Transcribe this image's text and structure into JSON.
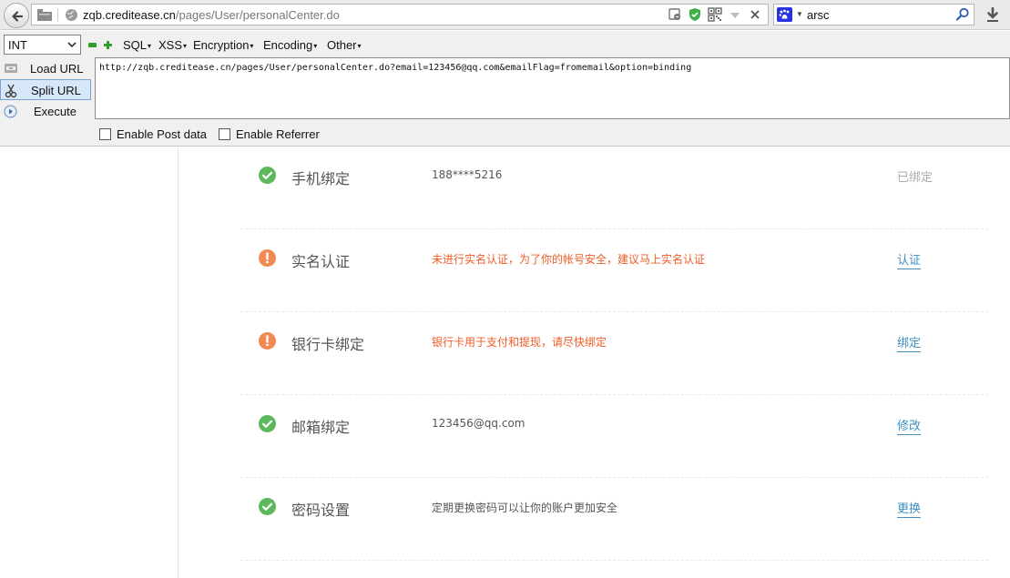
{
  "browser": {
    "address_bar": {
      "host": "zqb.creditease.cn",
      "path": "/pages/User/personalCenter.do"
    },
    "search": {
      "value": "arsc"
    }
  },
  "hackbar": {
    "select_value": "INT",
    "menus": [
      "SQL",
      "XSS",
      "Encryption",
      "Encoding",
      "Other"
    ],
    "buttons": {
      "load_url": "Load URL",
      "split_url": "Split URL",
      "execute": "Execute"
    },
    "url_value": "http://zqb.creditease.cn/pages/User/personalCenter.do?email=123456@qq.com&emailFlag=fromemail&option=binding",
    "options": {
      "post_data": "Enable Post data",
      "referrer": "Enable Referrer"
    }
  },
  "security": {
    "rows": [
      {
        "title": "手机绑定",
        "desc": "188****5216",
        "action": "已绑定",
        "status": "ok"
      },
      {
        "title": "实名认证",
        "desc": "未进行实名认证，为了你的帐号安全，建议马上实名认证",
        "action": "认证",
        "status": "warn"
      },
      {
        "title": "银行卡绑定",
        "desc": "银行卡用于支付和提现，请尽快绑定",
        "action": "绑定",
        "status": "warn"
      },
      {
        "title": "邮箱绑定",
        "desc": "123456@qq.com",
        "action": "修改",
        "status": "ok"
      },
      {
        "title": "密码设置",
        "desc": "定期更换密码可以让你的账户更加安全",
        "action": "更换",
        "status": "ok"
      }
    ]
  },
  "colors": {
    "ok": "#5cb85c",
    "warn": "#f08a52",
    "alert_text": "#f05c26",
    "link": "#3d8fc2"
  }
}
